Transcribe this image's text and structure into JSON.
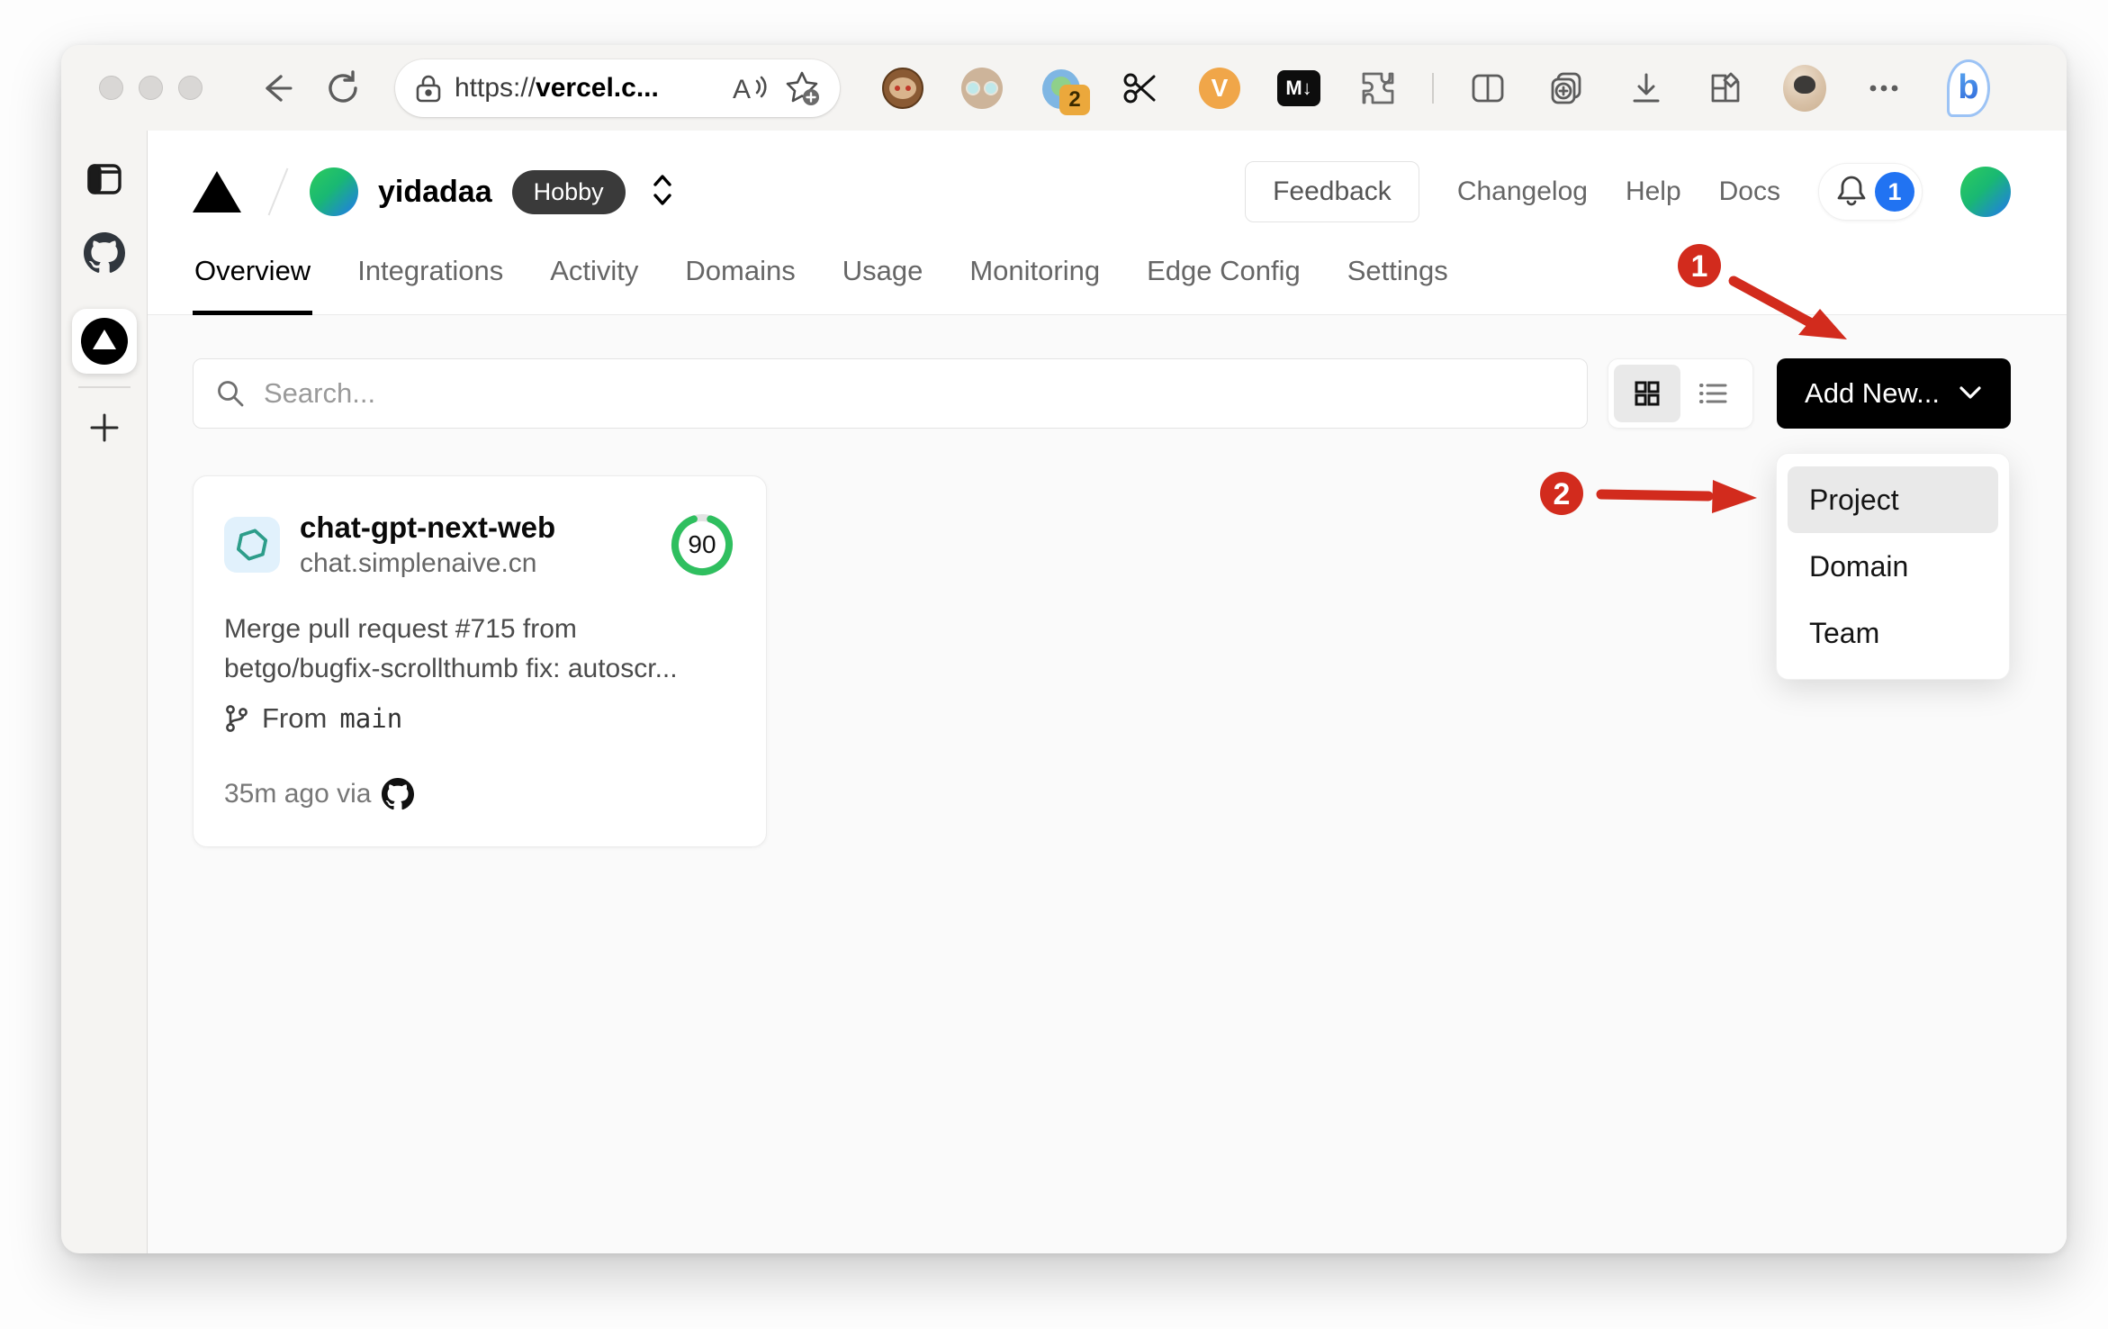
{
  "browser": {
    "window_controls": [
      "close",
      "minimize",
      "zoom"
    ],
    "url": {
      "prefix": "https://",
      "domain_visible": "vercel.c..."
    },
    "toolbar_icons": [
      "back-icon",
      "refresh-icon",
      "lock-icon",
      "read-aloud-icon",
      "add-favorite-icon",
      "split-screen-icon",
      "collections-icon",
      "downloads-icon",
      "browser-essentials-icon",
      "profile-avatar",
      "more-menu-icon",
      "bing-chat-icon"
    ],
    "extensions": {
      "badge_count": "2",
      "v_letter": "V",
      "md_letter": "M↓",
      "bing_letter": "b",
      "read_aloud_letter": "A"
    }
  },
  "sidebar": {
    "items": [
      "panel-toggle",
      "github-tab",
      "vercel-tab-active",
      "new-tab"
    ]
  },
  "vercel": {
    "team": "yidadaa",
    "plan": "Hobby",
    "nav": [
      "Overview",
      "Integrations",
      "Activity",
      "Domains",
      "Usage",
      "Monitoring",
      "Edge Config",
      "Settings"
    ],
    "header": {
      "feedback": "Feedback",
      "changelog": "Changelog",
      "help": "Help",
      "docs": "Docs",
      "notification_count": "1"
    },
    "toolbar": {
      "search_placeholder": "Search...",
      "add_new": "Add New..."
    },
    "dropdown": {
      "items": [
        "Project",
        "Domain",
        "Team"
      ],
      "highlighted": "Project"
    },
    "project": {
      "name": "chat-gpt-next-web",
      "domain": "chat.simplenaive.cn",
      "score": "90",
      "commit_lines": [
        "Merge pull request #715 from",
        "betgo/bugfix-scrollthumb fix: autoscr..."
      ],
      "branch_prefix": "From",
      "branch_name": "main",
      "deployed_meta": "35m ago via"
    }
  },
  "annotations": {
    "step1": "1",
    "step2": "2"
  },
  "colors": {
    "annotation_red": "#d22b1d",
    "accent_blue": "#2173f2",
    "score_green": "#2fbf5f",
    "add_new_black": "#000000",
    "plan_badge_bg": "#3a3a3a",
    "body_gray": "#fafafa",
    "openai_teal": "#2d9d8a",
    "openai_bg": "#e1f1fc"
  }
}
